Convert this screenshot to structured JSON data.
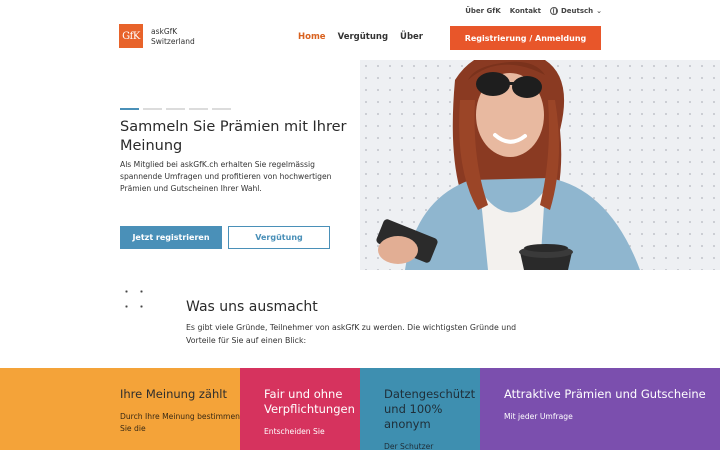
{
  "utility": {
    "about": "Über GfK",
    "contact": "Kontakt",
    "language": "Deutsch"
  },
  "brand": {
    "logo_text": "GfK",
    "name_line1": "askGfK",
    "name_line2": "Switzerland"
  },
  "nav": {
    "items": [
      "Home",
      "Vergütung",
      "Über"
    ],
    "active": "Home",
    "cta": "Registrierung / Anmeldung"
  },
  "hero": {
    "slide_count": 5,
    "active_slide": 1,
    "title": "Sammeln Sie Prämien mit Ihrer Meinung",
    "text": "Als Mitglied bei askGfK.ch erhalten Sie regelmässig spannende Umfragen und profitieren von hochwertigen Prämien und Gutscheinen Ihrer Wahl.",
    "primary_button": "Jetzt registrieren",
    "secondary_button": "Vergütung"
  },
  "section": {
    "title": "Was uns ausmacht",
    "text": "Es gibt viele Gründe, Teilnehmer von askGfK zu werden. Die wichtigsten Gründe und Vorteile für Sie auf einen Blick:"
  },
  "tiles": [
    {
      "title": "Ihre Meinung zählt",
      "body": "Durch Ihre Meinung bestimmen Sie die"
    },
    {
      "title": "Fair und ohne Verpflichtungen",
      "body": "Entscheiden Sie"
    },
    {
      "title": "Datengeschützt und 100% anonym",
      "body": "Der Schutzer"
    },
    {
      "title": "Attraktive Prämien und Gutscheine",
      "body": "Mit jeder Umfrage"
    }
  ],
  "colors": {
    "accent_orange": "#e8562a",
    "accent_blue": "#4a90b8",
    "tile_orange": "#f4a339",
    "tile_pink": "#d6335e",
    "tile_teal": "#3e8fb0",
    "tile_purple": "#7b4fae"
  }
}
